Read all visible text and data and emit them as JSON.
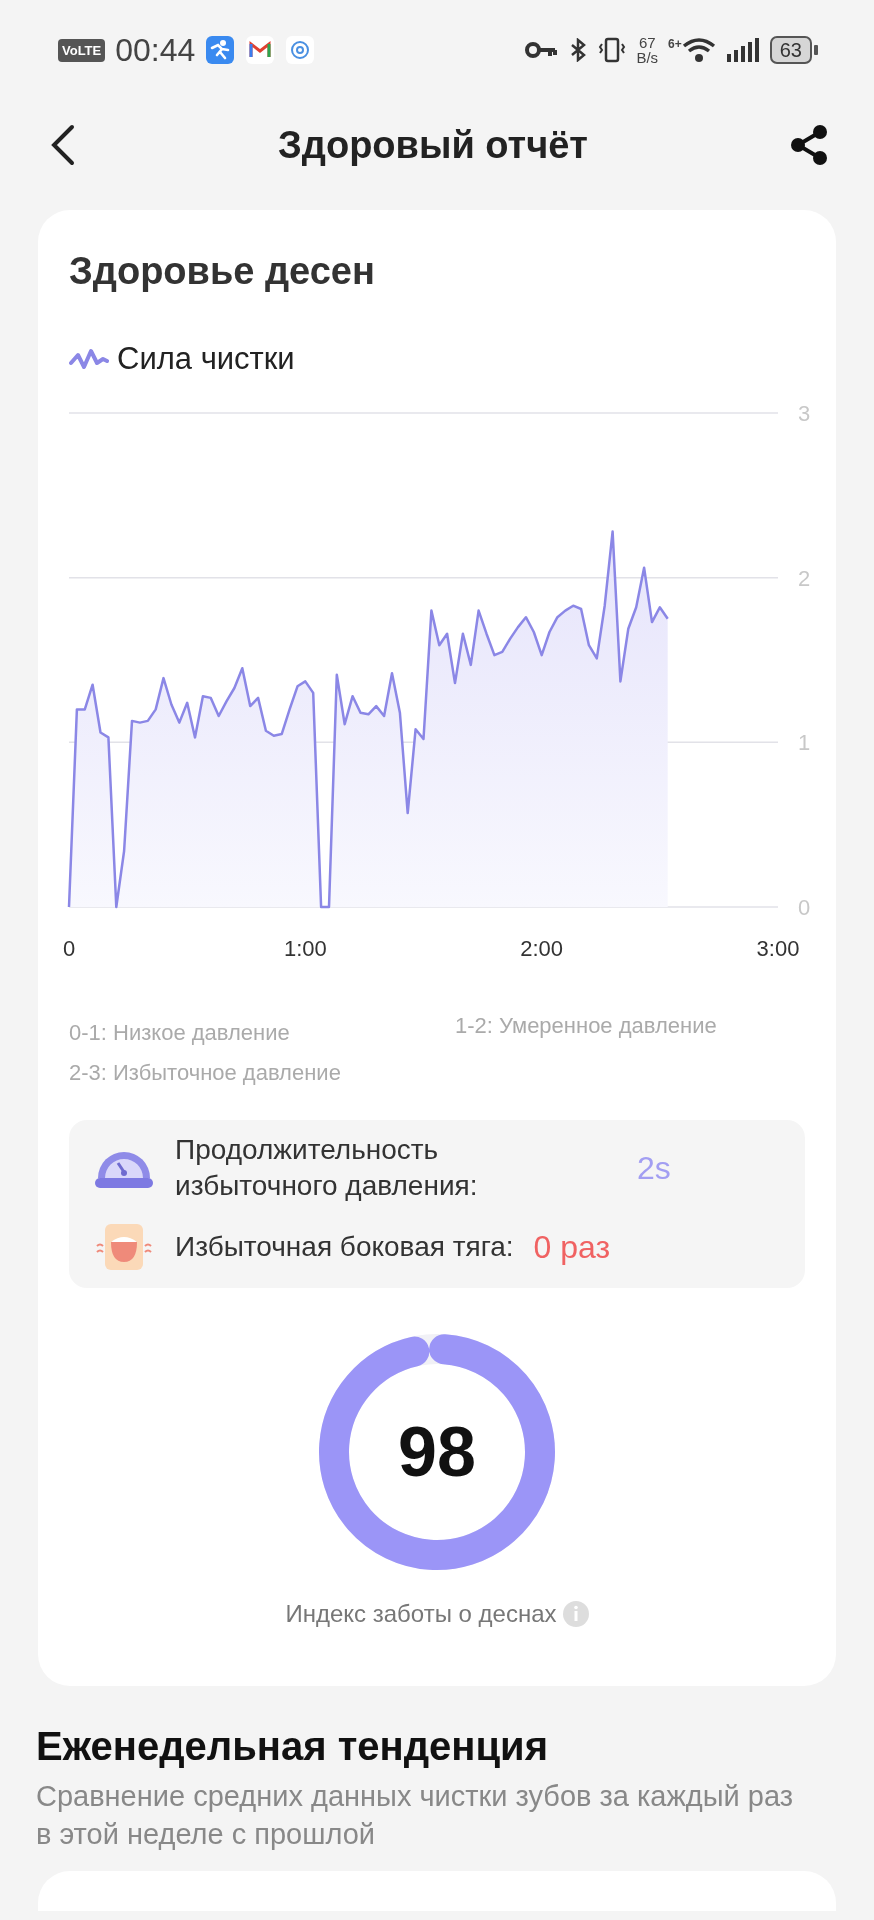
{
  "status_bar": {
    "network_badge": "VoLTE",
    "time": "00:44",
    "speed_value": "67",
    "speed_unit": "B/s",
    "wifi_badge": "6+",
    "battery": "63"
  },
  "header": {
    "title": "Здоровый отчёт"
  },
  "gum_card": {
    "title": "Здоровье десен",
    "chart_data": {
      "type": "area",
      "title": "Сила чистки",
      "xlim": [
        0,
        180
      ],
      "ylim": [
        0,
        3
      ],
      "xticks": [
        {
          "value": 0,
          "label": "0"
        },
        {
          "value": 60,
          "label": "1:00"
        },
        {
          "value": 120,
          "label": "2:00"
        },
        {
          "value": 180,
          "label": "3:00"
        }
      ],
      "yticks": [
        0,
        1,
        2,
        3
      ],
      "x": [
        0,
        2,
        4,
        6,
        8,
        10,
        12,
        14,
        16,
        18,
        20,
        22,
        24,
        26,
        28,
        30,
        32,
        34,
        36,
        38,
        40,
        42,
        44,
        46,
        48,
        50,
        52,
        54,
        56,
        58,
        60,
        62,
        64,
        66,
        68,
        70,
        72,
        74,
        76,
        78,
        80,
        82,
        84,
        86,
        88,
        90,
        92,
        94,
        96,
        98,
        100,
        102,
        104,
        106,
        108,
        110,
        112,
        114,
        116,
        118,
        120,
        122,
        124,
        126,
        128,
        130,
        132,
        134,
        136,
        138,
        140,
        142,
        144,
        146,
        148,
        150,
        152
      ],
      "series": [
        {
          "color": "#8b87e6",
          "values": [
            0,
            1.2,
            1.2,
            1.35,
            1.06,
            1.03,
            0,
            0.34,
            1.13,
            1.12,
            1.13,
            1.2,
            1.39,
            1.23,
            1.12,
            1.24,
            1.03,
            1.28,
            1.27,
            1.16,
            1.25,
            1.33,
            1.45,
            1.22,
            1.27,
            1.07,
            1.04,
            1.05,
            1.2,
            1.34,
            1.37,
            1.3,
            0,
            0,
            1.41,
            1.11,
            1.28,
            1.18,
            1.17,
            1.22,
            1.16,
            1.42,
            1.18,
            0.57,
            1.08,
            1.02,
            1.8,
            1.59,
            1.66,
            1.36,
            1.66,
            1.47,
            1.8,
            1.66,
            1.53,
            1.55,
            1.63,
            1.7,
            1.76,
            1.67,
            1.53,
            1.67,
            1.76,
            1.8,
            1.83,
            1.81,
            1.59,
            1.51,
            1.83,
            2.28,
            1.37,
            1.69,
            1.82,
            2.06,
            1.73,
            1.82,
            1.75
          ]
        }
      ]
    },
    "legend": [
      "0-1: Низкое давление",
      "1-2: Умеренное давление",
      "2-3: Избыточное давление"
    ],
    "stats": [
      {
        "kind": "gauge",
        "label": "Продолжительность избыточного давления:",
        "value": "2s",
        "color": "#a29ef2"
      },
      {
        "kind": "tooth",
        "label": "Избыточная боковая тяга:",
        "value": "0 раз",
        "color": "#f06262"
      }
    ],
    "score": {
      "value": "98",
      "level": 0.98,
      "label": "Индекс заботы о деснах"
    }
  },
  "weekly": {
    "title": "Еженедельная тенденция",
    "subtitle": "Сравнение средних данных чистки зубов за каждый раз в этой неделе с прошлой"
  }
}
